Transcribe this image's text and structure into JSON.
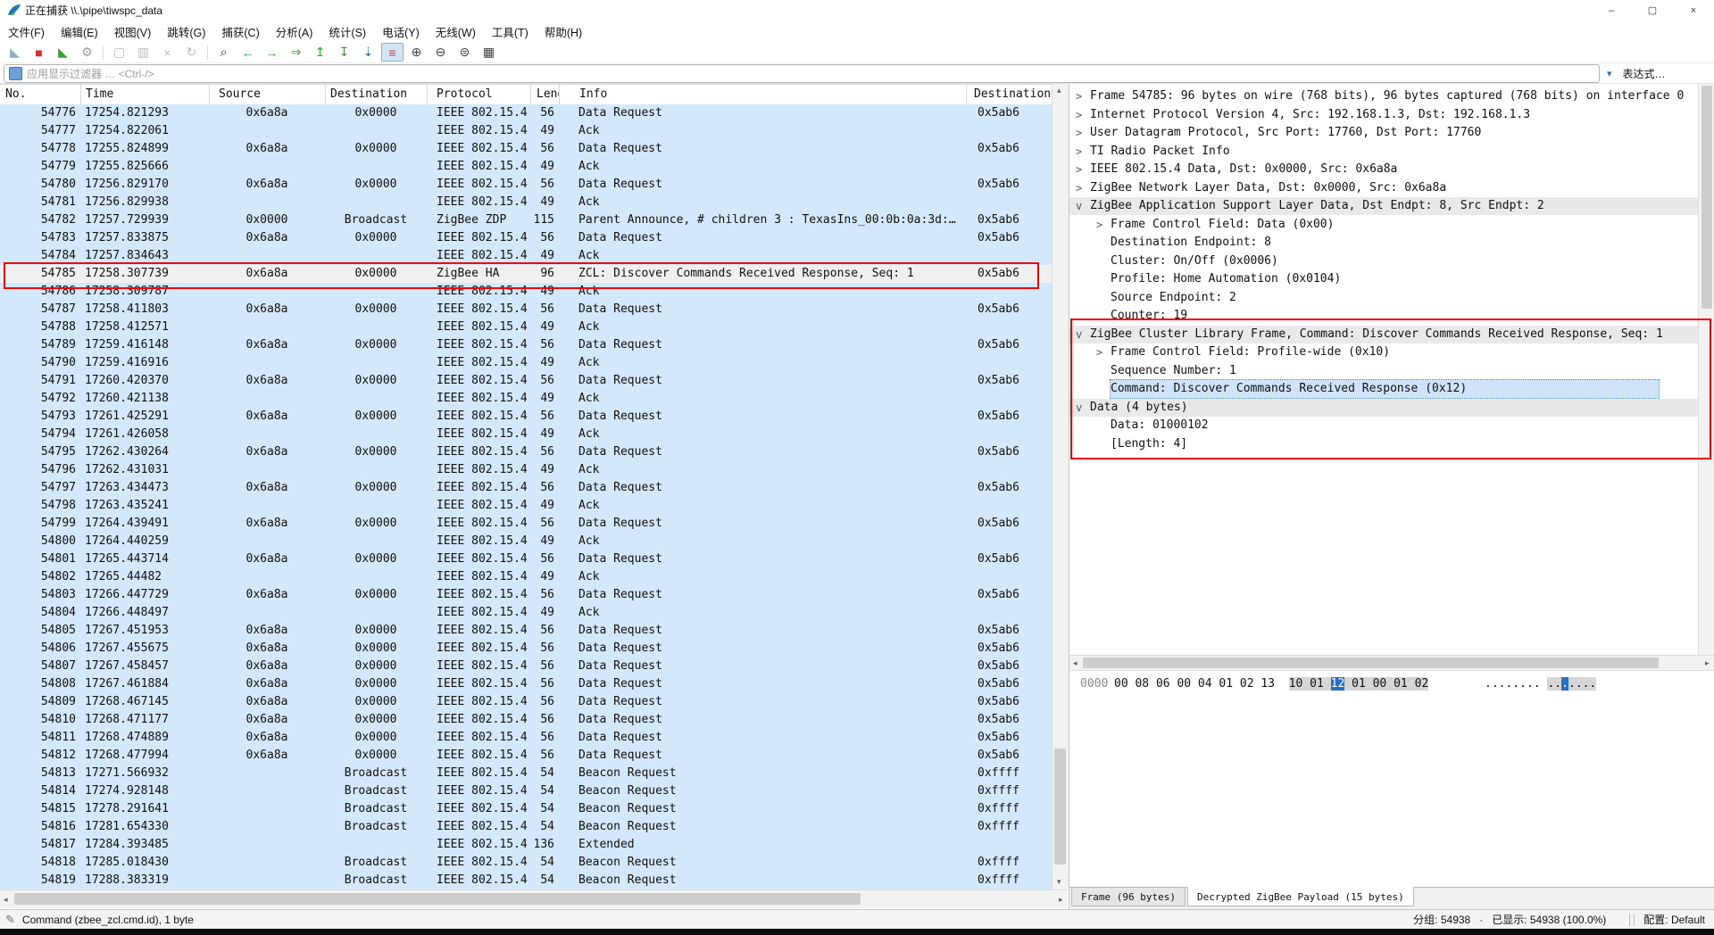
{
  "window": {
    "title": "正在捕获 \\\\.\\pipe\\tiwspc_data",
    "controls": [
      {
        "name": "minimize-button",
        "glyph": "–"
      },
      {
        "name": "maximize-button",
        "glyph": "▢"
      },
      {
        "name": "close-button",
        "glyph": "×"
      }
    ]
  },
  "menus": [
    "文件(F)",
    "编辑(E)",
    "视图(V)",
    "跳转(G)",
    "捕获(C)",
    "分析(A)",
    "统计(S)",
    "电话(Y)",
    "无线(W)",
    "工具(T)",
    "帮助(H)"
  ],
  "toolbar": [
    {
      "name": "start-capture-icon",
      "glyph": "◣",
      "color": "#8fb0c4"
    },
    {
      "name": "stop-capture-icon",
      "glyph": "■",
      "color": "#d03030"
    },
    {
      "name": "restart-capture-icon",
      "glyph": "◣",
      "color": "#35a235"
    },
    {
      "name": "capture-options-icon",
      "glyph": "⚙",
      "color": "#9a9a9a"
    },
    {
      "sep": true
    },
    {
      "name": "open-file-icon",
      "glyph": "▢",
      "color": "#bcbcbc"
    },
    {
      "name": "save-file-icon",
      "glyph": "▥",
      "color": "#bcbcbc"
    },
    {
      "name": "close-file-icon",
      "glyph": "×",
      "color": "#bcbcbc"
    },
    {
      "name": "reload-icon",
      "glyph": "↻",
      "color": "#bcbcbc"
    },
    {
      "sep": true
    },
    {
      "name": "find-packet-icon",
      "glyph": "⌕",
      "color": "#404040"
    },
    {
      "name": "go-back-icon",
      "glyph": "←",
      "color": "#2f9e2f"
    },
    {
      "name": "go-forward-icon",
      "glyph": "→",
      "color": "#2f9e2f"
    },
    {
      "name": "go-to-packet-icon",
      "glyph": "⇒",
      "color": "#2f9e2f"
    },
    {
      "name": "go-first-icon",
      "glyph": "↥",
      "color": "#2f9e2f"
    },
    {
      "name": "go-last-icon",
      "glyph": "↧",
      "color": "#2f9e2f"
    },
    {
      "name": "auto-scroll-icon",
      "glyph": "⇣",
      "color": "#2b6fb5"
    },
    {
      "name": "colorize-icon",
      "glyph": "≡",
      "color": "#c04040",
      "active": true
    },
    {
      "name": "zoom-in-icon",
      "glyph": "⊕",
      "color": "#404040"
    },
    {
      "name": "zoom-out-icon",
      "glyph": "⊖",
      "color": "#404040"
    },
    {
      "name": "zoom-reset-icon",
      "glyph": "⊜",
      "color": "#404040"
    },
    {
      "name": "resize-columns-icon",
      "glyph": "▦",
      "color": "#404040"
    }
  ],
  "filter": {
    "placeholder": "应用显示过滤器 … <Ctrl-/>",
    "dropdown_glyph": "▾",
    "expression_label": "表达式…"
  },
  "packet_list": {
    "columns": [
      "No.",
      "Time",
      "Source",
      "Destination",
      "Protocol",
      "Length",
      "Info",
      "Destination PA"
    ],
    "selected_no": "54785",
    "rows": [
      [
        "54776",
        "17254.821293",
        "0x6a8a",
        "0x0000",
        "IEEE 802.15.4",
        "56",
        "Data Request",
        "0x5ab6"
      ],
      [
        "54777",
        "17254.822061",
        "",
        "",
        "IEEE 802.15.4",
        "49",
        "Ack",
        ""
      ],
      [
        "54778",
        "17255.824899",
        "0x6a8a",
        "0x0000",
        "IEEE 802.15.4",
        "56",
        "Data Request",
        "0x5ab6"
      ],
      [
        "54779",
        "17255.825666",
        "",
        "",
        "IEEE 802.15.4",
        "49",
        "Ack",
        ""
      ],
      [
        "54780",
        "17256.829170",
        "0x6a8a",
        "0x0000",
        "IEEE 802.15.4",
        "56",
        "Data Request",
        "0x5ab6"
      ],
      [
        "54781",
        "17256.829938",
        "",
        "",
        "IEEE 802.15.4",
        "49",
        "Ack",
        ""
      ],
      [
        "54782",
        "17257.729939",
        "0x0000",
        "Broadcast",
        "ZigBee ZDP",
        "115",
        "Parent Announce, # children 3 : TexasIns_00:0b:0a:3d:…",
        "0x5ab6"
      ],
      [
        "54783",
        "17257.833875",
        "0x6a8a",
        "0x0000",
        "IEEE 802.15.4",
        "56",
        "Data Request",
        "0x5ab6"
      ],
      [
        "54784",
        "17257.834643",
        "",
        "",
        "IEEE 802.15.4",
        "49",
        "Ack",
        ""
      ],
      [
        "54785",
        "17258.307739",
        "0x6a8a",
        "0x0000",
        "ZigBee HA",
        "96",
        "ZCL: Discover Commands Received Response, Seq: 1",
        "0x5ab6"
      ],
      [
        "54786",
        "17258.309787",
        "",
        "",
        "IEEE 802.15.4",
        "49",
        "Ack",
        ""
      ],
      [
        "54787",
        "17258.411803",
        "0x6a8a",
        "0x0000",
        "IEEE 802.15.4",
        "56",
        "Data Request",
        "0x5ab6"
      ],
      [
        "54788",
        "17258.412571",
        "",
        "",
        "IEEE 802.15.4",
        "49",
        "Ack",
        ""
      ],
      [
        "54789",
        "17259.416148",
        "0x6a8a",
        "0x0000",
        "IEEE 802.15.4",
        "56",
        "Data Request",
        "0x5ab6"
      ],
      [
        "54790",
        "17259.416916",
        "",
        "",
        "IEEE 802.15.4",
        "49",
        "Ack",
        ""
      ],
      [
        "54791",
        "17260.420370",
        "0x6a8a",
        "0x0000",
        "IEEE 802.15.4",
        "56",
        "Data Request",
        "0x5ab6"
      ],
      [
        "54792",
        "17260.421138",
        "",
        "",
        "IEEE 802.15.4",
        "49",
        "Ack",
        ""
      ],
      [
        "54793",
        "17261.425291",
        "0x6a8a",
        "0x0000",
        "IEEE 802.15.4",
        "56",
        "Data Request",
        "0x5ab6"
      ],
      [
        "54794",
        "17261.426058",
        "",
        "",
        "IEEE 802.15.4",
        "49",
        "Ack",
        ""
      ],
      [
        "54795",
        "17262.430264",
        "0x6a8a",
        "0x0000",
        "IEEE 802.15.4",
        "56",
        "Data Request",
        "0x5ab6"
      ],
      [
        "54796",
        "17262.431031",
        "",
        "",
        "IEEE 802.15.4",
        "49",
        "Ack",
        ""
      ],
      [
        "54797",
        "17263.434473",
        "0x6a8a",
        "0x0000",
        "IEEE 802.15.4",
        "56",
        "Data Request",
        "0x5ab6"
      ],
      [
        "54798",
        "17263.435241",
        "",
        "",
        "IEEE 802.15.4",
        "49",
        "Ack",
        ""
      ],
      [
        "54799",
        "17264.439491",
        "0x6a8a",
        "0x0000",
        "IEEE 802.15.4",
        "56",
        "Data Request",
        "0x5ab6"
      ],
      [
        "54800",
        "17264.440259",
        "",
        "",
        "IEEE 802.15.4",
        "49",
        "Ack",
        ""
      ],
      [
        "54801",
        "17265.443714",
        "0x6a8a",
        "0x0000",
        "IEEE 802.15.4",
        "56",
        "Data Request",
        "0x5ab6"
      ],
      [
        "54802",
        "17265.44482",
        "",
        "",
        "IEEE 802.15.4",
        "49",
        "Ack",
        ""
      ],
      [
        "54803",
        "17266.447729",
        "0x6a8a",
        "0x0000",
        "IEEE 802.15.4",
        "56",
        "Data Request",
        "0x5ab6"
      ],
      [
        "54804",
        "17266.448497",
        "",
        "",
        "IEEE 802.15.4",
        "49",
        "Ack",
        ""
      ],
      [
        "54805",
        "17267.451953",
        "0x6a8a",
        "0x0000",
        "IEEE 802.15.4",
        "56",
        "Data Request",
        "0x5ab6"
      ],
      [
        "54806",
        "17267.455675",
        "0x6a8a",
        "0x0000",
        "IEEE 802.15.4",
        "56",
        "Data Request",
        "0x5ab6"
      ],
      [
        "54807",
        "17267.458457",
        "0x6a8a",
        "0x0000",
        "IEEE 802.15.4",
        "56",
        "Data Request",
        "0x5ab6"
      ],
      [
        "54808",
        "17267.461884",
        "0x6a8a",
        "0x0000",
        "IEEE 802.15.4",
        "56",
        "Data Request",
        "0x5ab6"
      ],
      [
        "54809",
        "17268.467145",
        "0x6a8a",
        "0x0000",
        "IEEE 802.15.4",
        "56",
        "Data Request",
        "0x5ab6"
      ],
      [
        "54810",
        "17268.471177",
        "0x6a8a",
        "0x0000",
        "IEEE 802.15.4",
        "56",
        "Data Request",
        "0x5ab6"
      ],
      [
        "54811",
        "17268.474889",
        "0x6a8a",
        "0x0000",
        "IEEE 802.15.4",
        "56",
        "Data Request",
        "0x5ab6"
      ],
      [
        "54812",
        "17268.477994",
        "0x6a8a",
        "0x0000",
        "IEEE 802.15.4",
        "56",
        "Data Request",
        "0x5ab6"
      ],
      [
        "54813",
        "17271.566932",
        "",
        "Broadcast",
        "IEEE 802.15.4",
        "54",
        "Beacon Request",
        "0xffff"
      ],
      [
        "54814",
        "17274.928148",
        "",
        "Broadcast",
        "IEEE 802.15.4",
        "54",
        "Beacon Request",
        "0xffff"
      ],
      [
        "54815",
        "17278.291641",
        "",
        "Broadcast",
        "IEEE 802.15.4",
        "54",
        "Beacon Request",
        "0xffff"
      ],
      [
        "54816",
        "17281.654330",
        "",
        "Broadcast",
        "IEEE 802.15.4",
        "54",
        "Beacon Request",
        "0xffff"
      ],
      [
        "54817",
        "17284.393485",
        "",
        "",
        "IEEE 802.15.4",
        "136",
        "Extended",
        ""
      ],
      [
        "54818",
        "17285.018430",
        "",
        "Broadcast",
        "IEEE 802.15.4",
        "54",
        "Beacon Request",
        "0xffff"
      ],
      [
        "54819",
        "17288.383319",
        "",
        "Broadcast",
        "IEEE 802.15.4",
        "54",
        "Beacon Request",
        "0xffff"
      ]
    ]
  },
  "detail_tree": [
    {
      "arrow": ">",
      "indent": 0,
      "style": "plain",
      "text": "Frame 54785: 96 bytes on wire (768 bits), 96 bytes captured (768 bits) on interface 0"
    },
    {
      "arrow": ">",
      "indent": 0,
      "style": "plain",
      "text": "Internet Protocol Version 4, Src: 192.168.1.3, Dst: 192.168.1.3"
    },
    {
      "arrow": ">",
      "indent": 0,
      "style": "plain",
      "text": "User Datagram Protocol, Src Port: 17760, Dst Port: 17760"
    },
    {
      "arrow": ">",
      "indent": 0,
      "style": "plain",
      "text": "TI Radio Packet Info"
    },
    {
      "arrow": ">",
      "indent": 0,
      "style": "plain",
      "text": "IEEE 802.15.4 Data, Dst: 0x0000, Src: 0x6a8a"
    },
    {
      "arrow": ">",
      "indent": 0,
      "style": "plain",
      "text": "ZigBee Network Layer Data, Dst: 0x0000, Src: 0x6a8a"
    },
    {
      "arrow": "v",
      "indent": 0,
      "style": "section",
      "text": "ZigBee Application Support Layer Data, Dst Endpt: 8, Src Endpt: 2"
    },
    {
      "arrow": ">",
      "indent": 1,
      "style": "plain",
      "text": "Frame Control Field: Data (0x00)"
    },
    {
      "arrow": "",
      "indent": 1,
      "style": "plain",
      "text": "Destination Endpoint: 8"
    },
    {
      "arrow": "",
      "indent": 1,
      "style": "plain",
      "text": "Cluster: On/Off (0x0006)"
    },
    {
      "arrow": "",
      "indent": 1,
      "style": "plain",
      "text": "Profile: Home Automation (0x0104)"
    },
    {
      "arrow": "",
      "indent": 1,
      "style": "plain",
      "text": "Source Endpoint: 2"
    },
    {
      "arrow": "",
      "indent": 1,
      "style": "plain",
      "text": "Counter: 19"
    },
    {
      "arrow": "v",
      "indent": 0,
      "style": "section",
      "text": "ZigBee Cluster Library Frame, Command: Discover Commands Received Response, Seq: 1"
    },
    {
      "arrow": ">",
      "indent": 1,
      "style": "plain",
      "text": "Frame Control Field: Profile-wide (0x10)"
    },
    {
      "arrow": "",
      "indent": 1,
      "style": "plain",
      "text": "Sequence Number: 1"
    },
    {
      "arrow": "",
      "indent": 1,
      "style": "selected",
      "text": "Command: Discover Commands Received Response (0x12)"
    },
    {
      "arrow": "v",
      "indent": 0,
      "style": "section",
      "text": "Data (4 bytes)"
    },
    {
      "arrow": "",
      "indent": 1,
      "style": "plain",
      "text": "Data: 01000102"
    },
    {
      "arrow": "",
      "indent": 1,
      "style": "plain",
      "text": "[Length: 4]"
    }
  ],
  "hex": {
    "offset": "0000",
    "byte_groups": [
      {
        "text": "00 08 06 00 04 01 02 13",
        "style": "normal"
      },
      {
        "text": "10 01",
        "style": "field"
      },
      {
        "text": "12",
        "style": "selected"
      },
      {
        "text": "01 00 01 02",
        "style": "field"
      }
    ],
    "ascii_groups": [
      {
        "text": "........",
        "style": "normal"
      },
      {
        "text": "..",
        "style": "field"
      },
      {
        "text": ".",
        "style": "selected"
      },
      {
        "text": "....",
        "style": "field"
      }
    ]
  },
  "byte_tabs": [
    {
      "label": "Frame (96 bytes)",
      "active": false
    },
    {
      "label": "Decrypted ZigBee Payload (15 bytes)",
      "active": true
    }
  ],
  "status": {
    "field_info": "Command (zbee_zcl.cmd.id), 1 byte",
    "packets": "分组: 54938",
    "dot": "·",
    "displayed": "已显示: 54938 (100.0%)",
    "profile": "配置: Default"
  },
  "colors": {
    "row_blue": "#d3e8fa",
    "row_selected": "#f0f0f0",
    "annotation_red": "#f20000",
    "hex_selected_bg": "#2a6fc4",
    "hex_field_bg": "#d6d6d6",
    "tree_section_bg": "#e9e9e9",
    "tree_selected_bg": "#cfe4f8"
  }
}
